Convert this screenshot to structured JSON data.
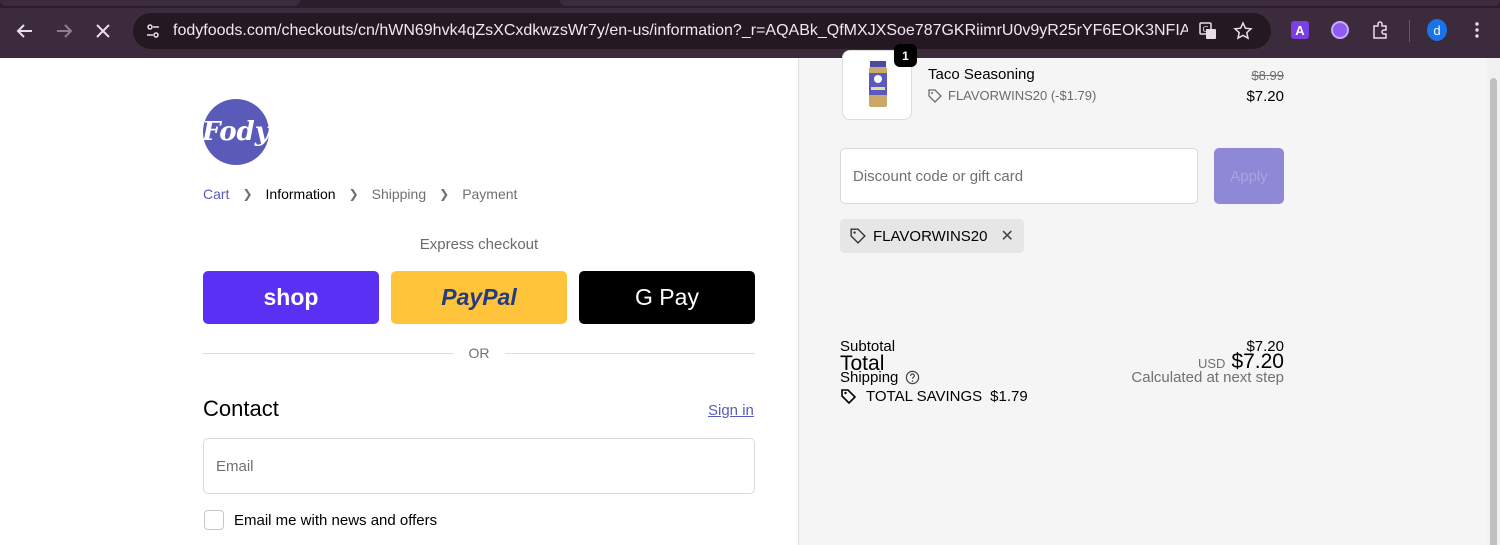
{
  "browser": {
    "url": "fodyfoods.com/checkouts/cn/hWN69hvk4qZsXCxdkwzsWr7y/en-us/information?_r=AQABk_QfMXJXSoe787GKRiimrU0v9yR25rYF6EOK3NFIAeo&au...",
    "profile_initial": "d",
    "extension_a_label": "A"
  },
  "store": {
    "logo_text": "Fody"
  },
  "breadcrumb": {
    "items": [
      "Cart",
      "Information",
      "Shipping",
      "Payment"
    ]
  },
  "express": {
    "heading": "Express checkout",
    "shop_label": "shop",
    "paypal_label": "PayPal",
    "gpay_label": "G Pay",
    "divider": "OR"
  },
  "contact": {
    "heading": "Contact",
    "sign_in": "Sign in",
    "email_placeholder": "Email",
    "newsletter_label": "Email me with news and offers",
    "newsletter_checked": false
  },
  "summary": {
    "product": {
      "name": "Taco Seasoning",
      "quantity": "1",
      "discount_line": "FLAVORWINS20 (-$1.79)",
      "original_price": "$8.99",
      "price": "$7.20"
    },
    "discount_placeholder": "Discount code or gift card",
    "apply_label": "Apply",
    "applied_code": "FLAVORWINS20",
    "subtotal_label": "Subtotal",
    "subtotal_value": "$7.20",
    "shipping_label": "Shipping",
    "shipping_value": "Calculated at next step",
    "total_label": "Total",
    "total_currency": "USD",
    "total_value": "$7.20",
    "savings_label": "TOTAL SAVINGS",
    "savings_value": "$1.79"
  },
  "colors": {
    "accent": "#5a5bb8",
    "shop": "#5a31f4",
    "paypal": "#ffc439",
    "apply_disabled": "#8e88d6"
  }
}
